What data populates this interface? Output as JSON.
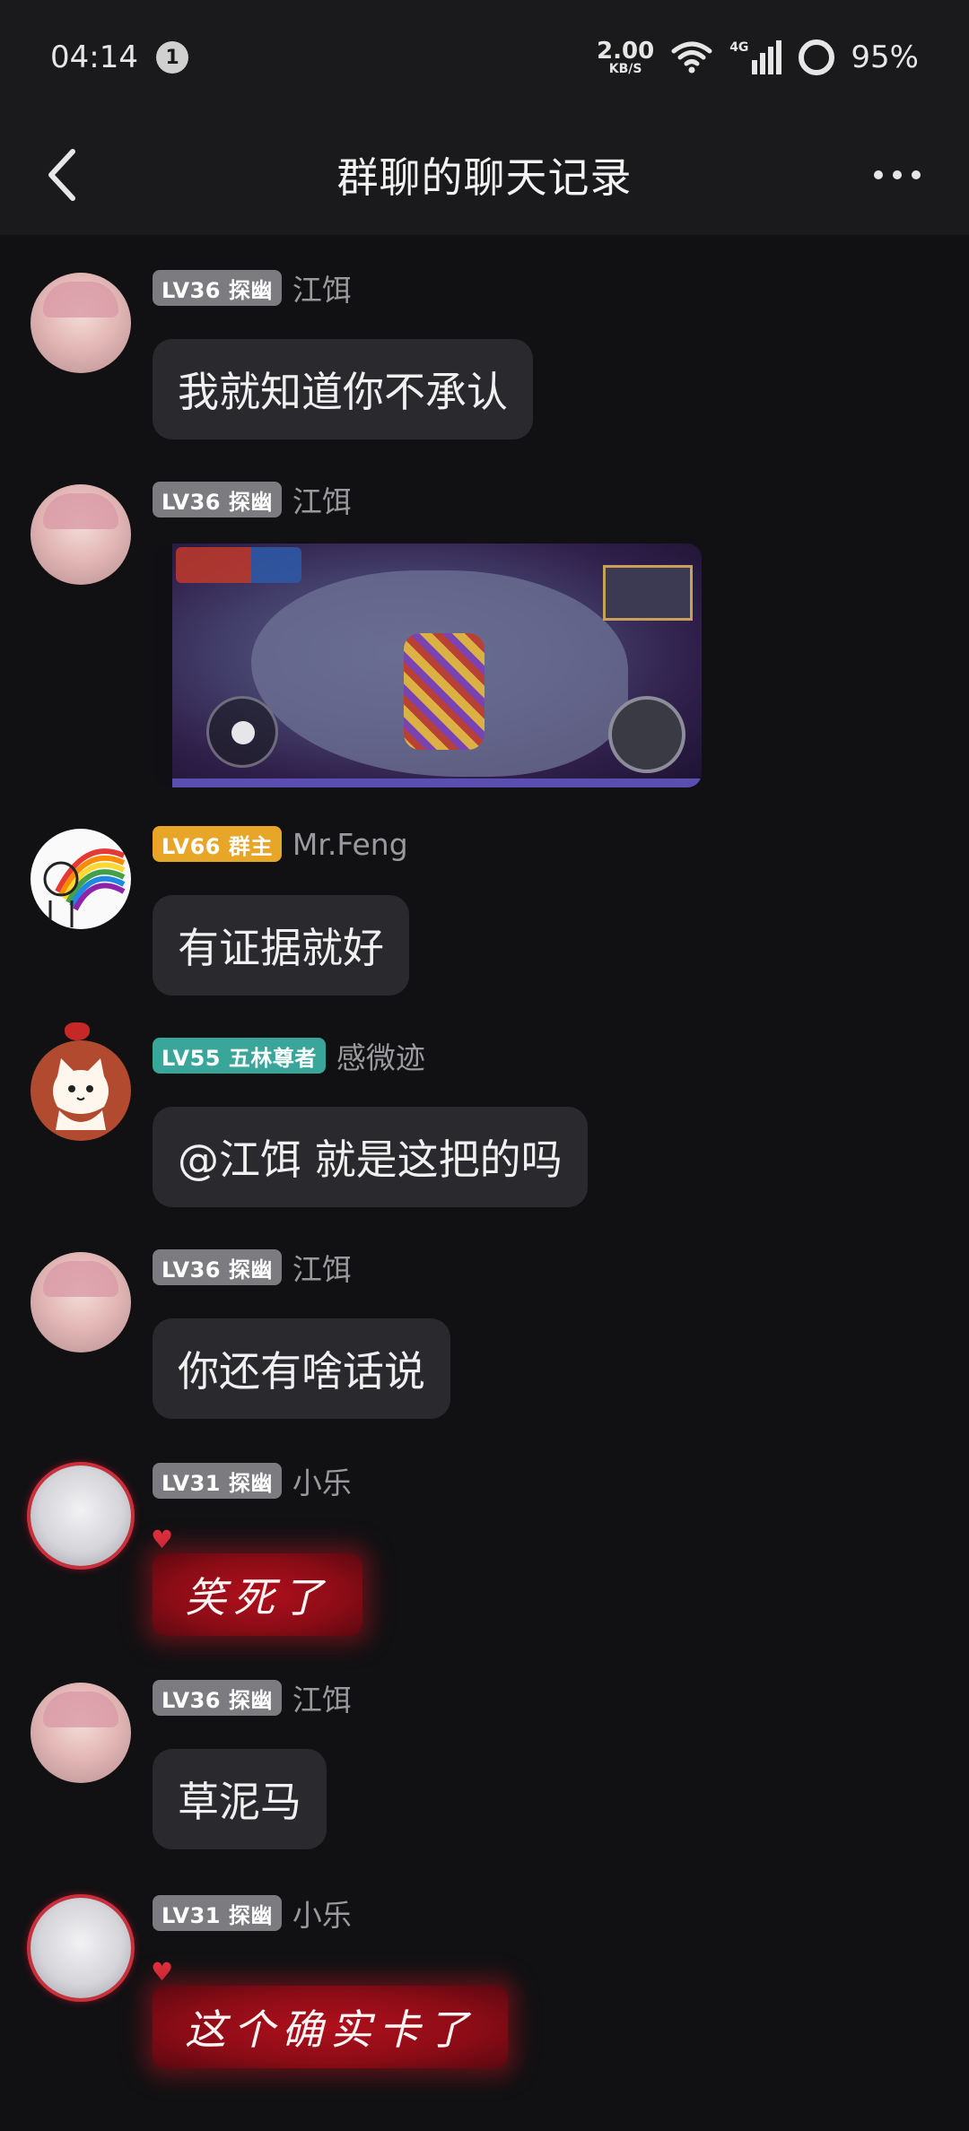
{
  "status_bar": {
    "time": "04:14",
    "notification_count": "1",
    "net_speed_value": "2.00",
    "net_speed_unit": "KB/S",
    "network_type": "4G",
    "battery": "95%"
  },
  "header": {
    "title": "群聊的聊天记录"
  },
  "messages": [
    {
      "level": "LV36 探幽",
      "sender": "江饵",
      "text": "我就知道你不承认"
    },
    {
      "level": "LV36 探幽",
      "sender": "江饵",
      "text": ""
    },
    {
      "level": "LV66 群主",
      "sender": "Mr.Feng",
      "text": "有证据就好"
    },
    {
      "level": "LV55 五林尊者",
      "sender": "感微迹",
      "text": "@江饵 就是这把的吗"
    },
    {
      "level": "LV36 探幽",
      "sender": "江饵",
      "text": "你还有啥话说"
    },
    {
      "level": "LV31 探幽",
      "sender": "小乐",
      "text": "笑死了"
    },
    {
      "level": "LV36 探幽",
      "sender": "江饵",
      "text": "草泥马"
    },
    {
      "level": "LV31 探幽",
      "sender": "小乐",
      "text": "这个确实卡了"
    }
  ],
  "colors": {
    "background": "#111113",
    "bar": "#1a1a1c",
    "bubble": "#2a2a2e",
    "badge_gray": "#7c7c80",
    "badge_gold": "#e8a629",
    "badge_teal": "#3aa69a",
    "red_bubble": "#b0101c"
  }
}
